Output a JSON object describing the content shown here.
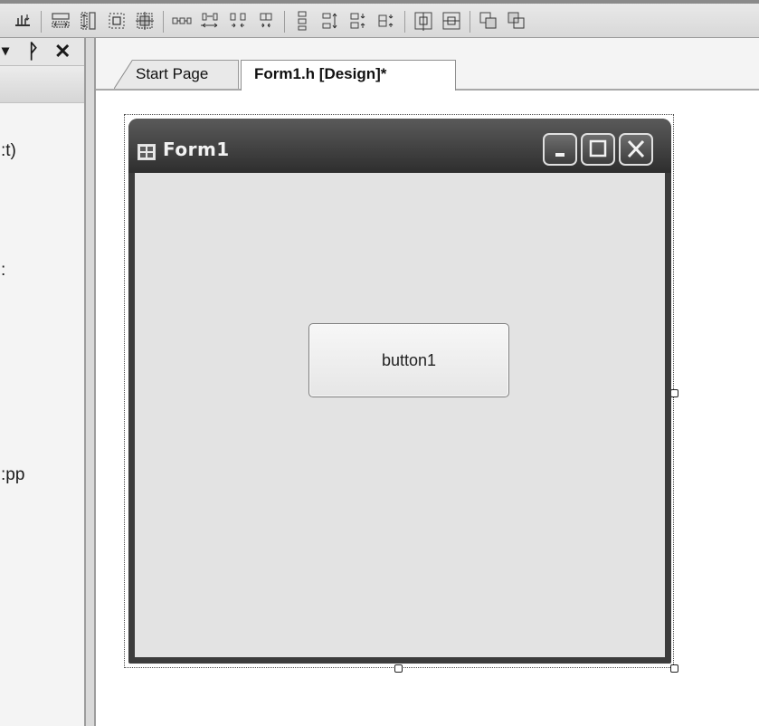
{
  "left_panel": {
    "visible_text": [
      ":t)",
      ":",
      ":pp"
    ]
  },
  "tabs": [
    {
      "label": "Start Page",
      "active": false
    },
    {
      "label": "Form1.h [Design]*",
      "active": true
    }
  ],
  "form": {
    "title": "Form1",
    "button_label": "button1"
  },
  "icons": {
    "panel": [
      "dropdown-arrow-icon",
      "pin-icon",
      "close-icon"
    ],
    "toolbar": [
      "align-to-grid-icon",
      "make-same-width-icon",
      "make-same-height-icon",
      "size-to-grid-icon",
      "make-same-size-icon",
      "equal-horizontal-spacing-icon",
      "increase-horizontal-spacing-icon",
      "decrease-horizontal-spacing-icon",
      "remove-horizontal-spacing-icon",
      "equal-vertical-spacing-icon",
      "increase-vertical-spacing-icon",
      "decrease-vertical-spacing-icon",
      "remove-vertical-spacing-icon",
      "center-horizontally-icon",
      "center-vertically-icon",
      "bring-to-front-icon"
    ],
    "window_caption": [
      "minimize-icon",
      "maximize-icon",
      "close-icon"
    ]
  },
  "colors": {
    "toolbar_bg": "#dedede",
    "titlebar": "#3c3c3c",
    "form_client": "#e3e3e3",
    "design_surface": "#ffffff"
  }
}
